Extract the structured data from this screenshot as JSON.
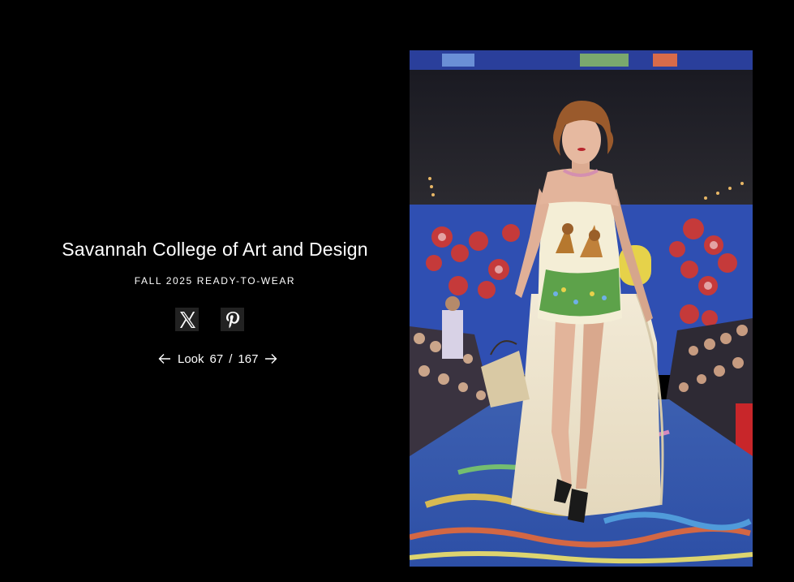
{
  "show": {
    "designer": "Savannah College of Art and Design",
    "season": "FALL 2025 READY-TO-WEAR"
  },
  "share": {
    "icons": [
      "x-logo-icon",
      "pinterest-logo-icon"
    ]
  },
  "pagination": {
    "label": "Look",
    "current": "67",
    "separator": "/",
    "total": "167"
  },
  "photo": {
    "description": "runway-look-photo"
  },
  "colors": {
    "background": "#000000",
    "text": "#ffffff",
    "icon_bg": "#222222"
  }
}
